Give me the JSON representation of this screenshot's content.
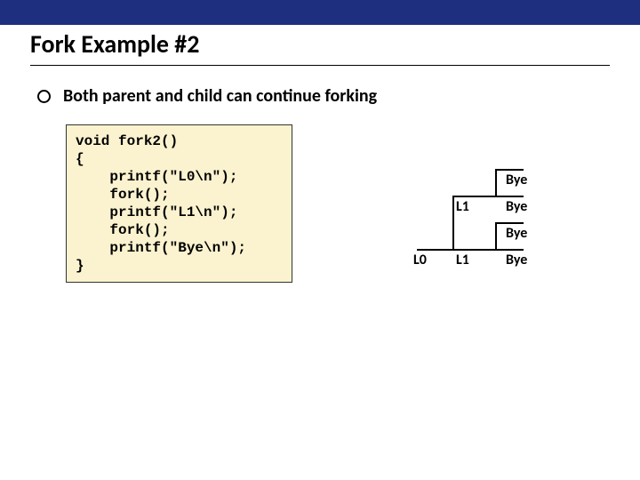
{
  "header": {
    "title": "Fork Example #2"
  },
  "bullet": {
    "text": "Both parent and child can continue forking"
  },
  "code": {
    "text": "void fork2()\n{\n    printf(\"L0\\n\");\n    fork();\n    printf(\"L1\\n\");\n    fork();\n    printf(\"Bye\\n\");\n}"
  },
  "diagram": {
    "L0": "L0",
    "L1a": "L1",
    "L1b": "L1",
    "Bye1": "Bye",
    "Bye2": "Bye",
    "Bye3": "Bye",
    "Bye4": "Bye"
  }
}
